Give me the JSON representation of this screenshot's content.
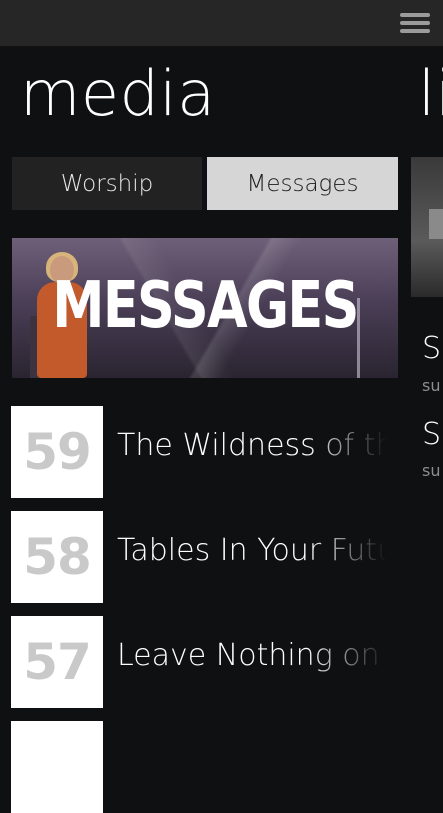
{
  "header": {
    "menu_icon": "hamburger-menu-icon"
  },
  "page": {
    "title": "media",
    "next_panorama_title": "li"
  },
  "tabs": [
    {
      "label": "Worship",
      "selected": false
    },
    {
      "label": "Messages",
      "selected": true
    }
  ],
  "banner": {
    "text": "MESSAGES"
  },
  "side_panel": {
    "items": [
      {
        "title": "Su",
        "subtitle": "su"
      },
      {
        "title": "Su",
        "subtitle": "su"
      }
    ]
  },
  "messages": [
    {
      "number": "59",
      "title": "The Wildness of th"
    },
    {
      "number": "58",
      "title": "Tables In Your Futu"
    },
    {
      "number": "57",
      "title": "Leave Nothing on t"
    },
    {
      "number": "",
      "title": ""
    }
  ],
  "colors": {
    "background": "#0f1012",
    "topbar": "#262626",
    "tab_inactive": "#222222",
    "tab_active": "#d6d6d6",
    "tile": "#ffffff",
    "tile_number": "#c9c9c9"
  }
}
